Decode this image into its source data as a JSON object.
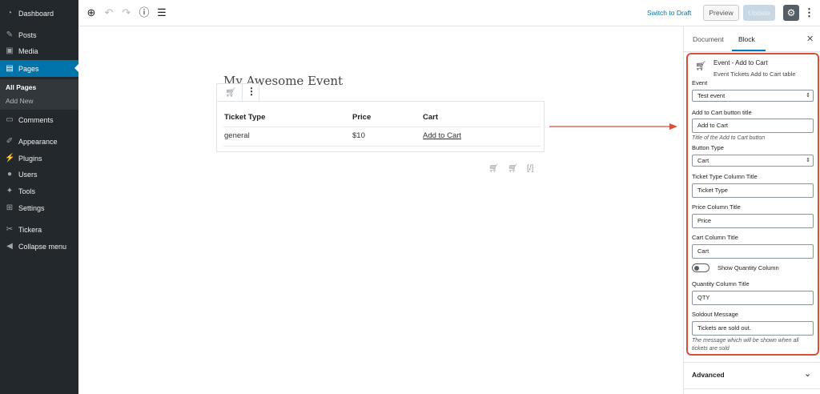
{
  "admin_menu": {
    "items": [
      {
        "label": "Dashboard",
        "icon": "dashboard-icon"
      },
      {
        "label": "Posts",
        "icon": "pin-icon"
      },
      {
        "label": "Media",
        "icon": "media-icon"
      },
      {
        "label": "Pages",
        "icon": "pages-icon"
      },
      {
        "label": "Comments",
        "icon": "comment-icon"
      },
      {
        "label": "Appearance",
        "icon": "brush-icon"
      },
      {
        "label": "Plugins",
        "icon": "plugin-icon"
      },
      {
        "label": "Users",
        "icon": "user-icon"
      },
      {
        "label": "Tools",
        "icon": "wrench-icon"
      },
      {
        "label": "Settings",
        "icon": "settings-icon"
      },
      {
        "label": "Tickera",
        "icon": "ticket-icon"
      },
      {
        "label": "Collapse menu",
        "icon": "collapse-icon"
      }
    ],
    "pages_submenu": [
      "All Pages",
      "Add New"
    ]
  },
  "toolbar": {
    "switch_to_draft": "Switch to Draft",
    "preview": "Preview",
    "update": "Update"
  },
  "editor": {
    "post_title": "My Awesome Event",
    "table": {
      "headers": [
        "Ticket Type",
        "Price",
        "Cart"
      ],
      "rows": [
        [
          "general",
          "$10",
          "Add to Cart"
        ]
      ]
    }
  },
  "settings": {
    "tabs": [
      "Document",
      "Block"
    ],
    "active_tab": "Block",
    "block_title": "Event - Add to Cart",
    "block_description": "Event Tickets Add to Cart table",
    "event_label": "Event",
    "event_value": "Test event",
    "button_title_label": "Add to Cart button title",
    "button_title_value": "Add to Cart",
    "button_title_help": "Title of the Add to Cart button",
    "button_type_label": "Button Type",
    "button_type_value": "Cart",
    "ticket_type_label": "Ticket Type Column Title",
    "ticket_type_value": "Ticket Type",
    "price_label": "Price Column Title",
    "price_value": "Price",
    "cart_label": "Cart Column Title",
    "cart_value": "Cart",
    "show_quantity_label": "Show Quantity Column",
    "show_quantity_enabled": false,
    "quantity_label": "Quantity Column Title",
    "quantity_value": "QTY",
    "soldout_label": "Soldout Message",
    "soldout_value": "Tickets are sold out.",
    "soldout_help": "The message which will be shown when all tickets are sold",
    "advanced": "Advanced"
  },
  "colors": {
    "admin_bg": "#23282d",
    "accent": "#0073aa",
    "annotation": "#d94f3c"
  }
}
